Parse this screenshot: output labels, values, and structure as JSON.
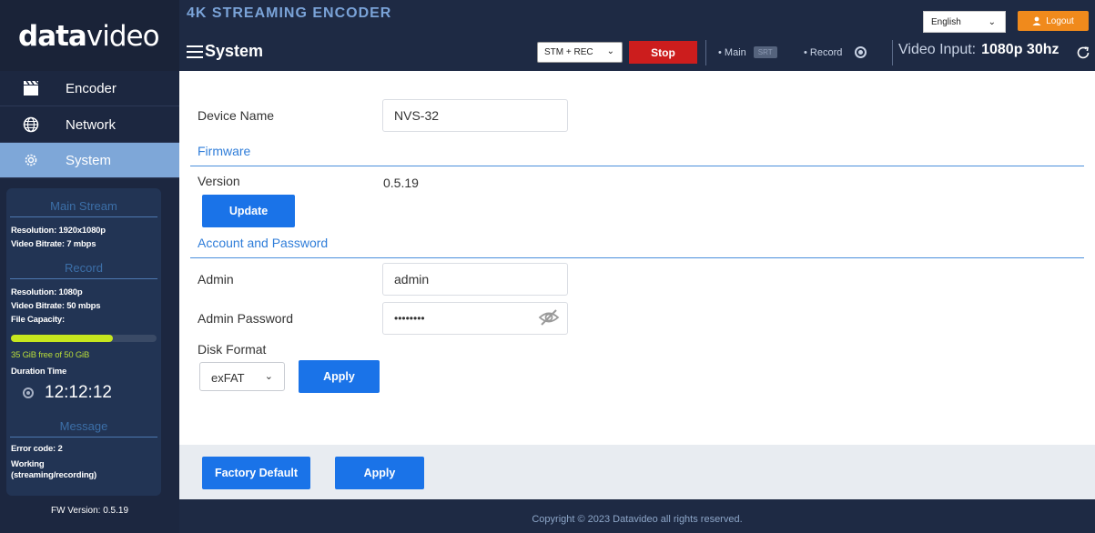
{
  "brand": {
    "logo_bold": "data",
    "logo_thin": "video"
  },
  "header": {
    "product": "4K STREAMING ENCODER",
    "page_title": "System",
    "language": "English",
    "logout_label": "Logout",
    "mode_select": "STM + REC",
    "stop_label": "Stop",
    "main_label": "• Main",
    "srt_badge": "SRT",
    "record_label": "• Record",
    "video_input_label": "Video Input:",
    "video_input_value": "1080p 30hz"
  },
  "sidebar": {
    "items": [
      {
        "label": "Encoder",
        "icon": "clapper-icon",
        "active": false
      },
      {
        "label": "Network",
        "icon": "globe-icon",
        "active": false
      },
      {
        "label": "System",
        "icon": "gear-icon",
        "active": true
      }
    ],
    "status": {
      "main_stream_title": "Main Stream",
      "main_resolution": "Resolution: 1920x1080p",
      "main_bitrate": "Video Bitrate: 7 mbps",
      "record_title": "Record",
      "record_resolution": "Resolution: 1080p",
      "record_bitrate": "Video Bitrate: 50 mbps",
      "file_capacity_label": "File Capacity:",
      "capacity_fraction": 0.7,
      "capacity_text": "35 GiB free of 50 GiB",
      "duration_label": "Duration Time",
      "duration_value": "12:12:12",
      "message_title": "Message",
      "error_code": "Error code: 2",
      "working_line1": "Working",
      "working_line2": "(streaming/recording)"
    },
    "fw_version": "FW Version: 0.5.19"
  },
  "main": {
    "device_name_label": "Device Name",
    "device_name_value": "NVS-32",
    "firmware_title": "Firmware",
    "version_label": "Version",
    "version_value": "0.5.19",
    "update_label": "Update",
    "account_title": "Account and Password",
    "admin_label": "Admin",
    "admin_value": "admin",
    "password_label": "Admin Password",
    "password_value": "••••••••",
    "disk_format_label": "Disk Format",
    "disk_format_value": "exFAT",
    "disk_apply_label": "Apply"
  },
  "actions": {
    "factory_default_label": "Factory Default",
    "apply_label": "Apply"
  },
  "footer": {
    "copyright": "Copyright © 2023 Datavideo all rights reserved."
  },
  "colors": {
    "accent": "#1a73e8",
    "stop": "#cc1d1d",
    "logout": "#f08a1c",
    "capacity": "#c6e61e",
    "sidebar_active": "#7ea7d8"
  }
}
